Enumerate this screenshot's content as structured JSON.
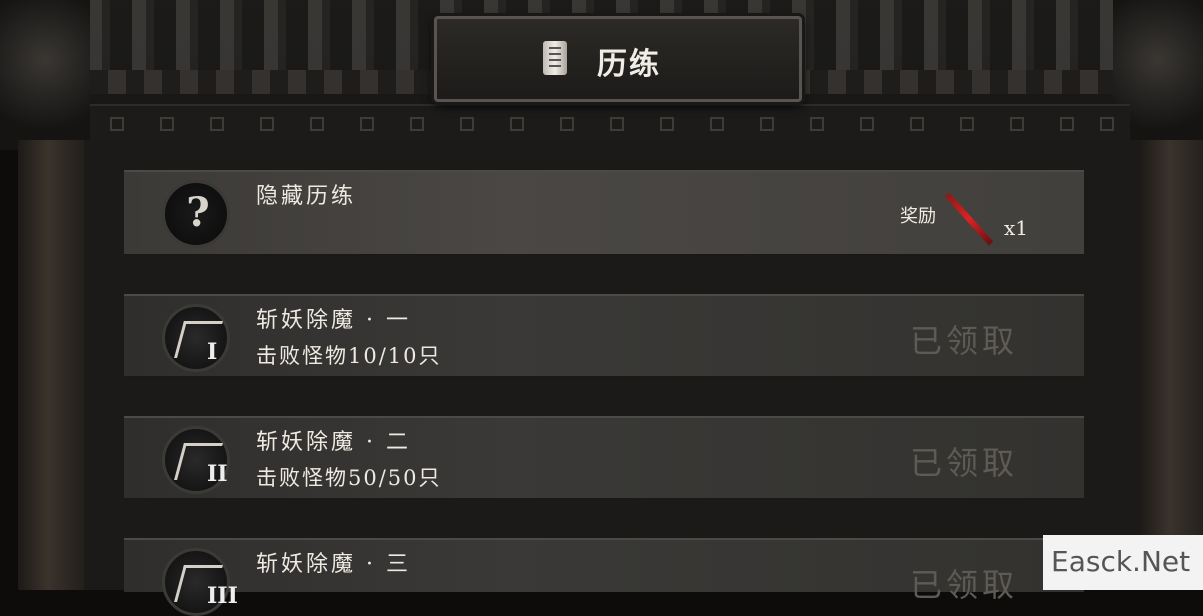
{
  "header": {
    "title": "历练",
    "icon": "scroll-icon"
  },
  "hidden_achievement": {
    "title": "隐藏历练",
    "reward_label": "奖励",
    "reward_item_icon": "red-sword-icon",
    "reward_qty": "x1"
  },
  "achievements": [
    {
      "title": "斩妖除魔 · 一",
      "progress": "击败怪物10/10只",
      "status": "已领取",
      "tier": "I"
    },
    {
      "title": "斩妖除魔 · 二",
      "progress": "击败怪物50/50只",
      "status": "已领取",
      "tier": "II"
    },
    {
      "title": "斩妖除魔 · 三",
      "progress": "",
      "status": "已领取",
      "tier": "III"
    }
  ],
  "watermark": "Easck.Net"
}
